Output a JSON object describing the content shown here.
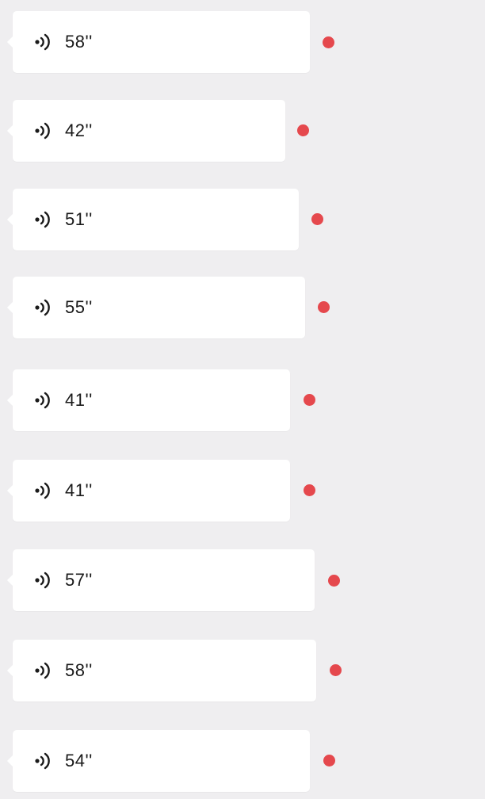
{
  "messages": [
    {
      "duration": "58''",
      "type": "voice",
      "icon": "voice-wave-icon",
      "unread": true
    },
    {
      "duration": "42''",
      "type": "voice",
      "icon": "voice-wave-icon",
      "unread": true
    },
    {
      "duration": "51''",
      "type": "voice",
      "icon": "voice-wave-icon",
      "unread": true
    },
    {
      "duration": "55''",
      "type": "voice",
      "icon": "voice-wave-icon",
      "unread": true
    },
    {
      "duration": "41''",
      "type": "voice",
      "icon": "voice-wave-icon",
      "unread": true
    },
    {
      "duration": "41''",
      "type": "voice",
      "icon": "voice-wave-icon",
      "unread": true
    },
    {
      "duration": "57''",
      "type": "voice",
      "icon": "voice-wave-icon",
      "unread": true
    },
    {
      "duration": "58''",
      "type": "voice",
      "icon": "voice-wave-icon",
      "unread": true
    },
    {
      "duration": "54''",
      "type": "voice",
      "icon": "voice-wave-icon",
      "unread": true
    }
  ],
  "colors": {
    "background": "#efeef0",
    "bubble": "#ffffff",
    "text": "#1a1a1a",
    "unread_dot": "#e5484d"
  }
}
